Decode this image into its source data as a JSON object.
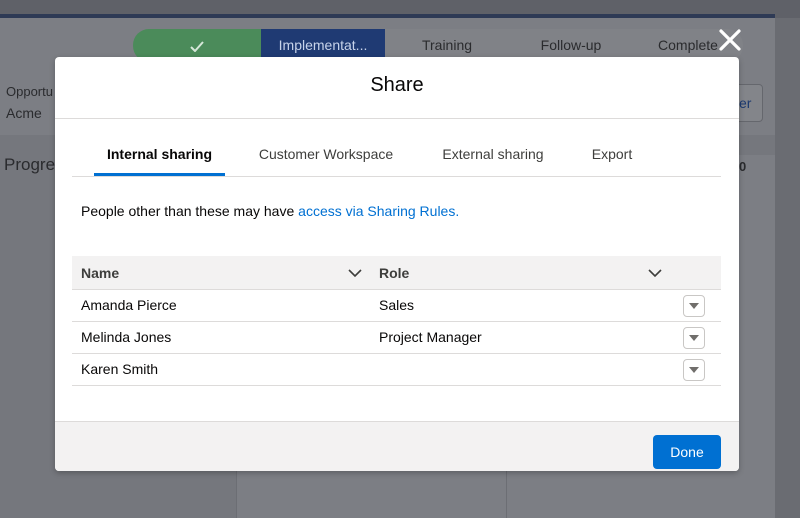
{
  "background": {
    "path_steps": [
      "",
      "Implementat...",
      "Training",
      "Follow-up",
      "Complete"
    ],
    "opportunity_label": "Opportu",
    "account_name": "Acme",
    "section_title": "Progres",
    "header_button_label": "er",
    "right_value": "0"
  },
  "modal": {
    "title": "Share",
    "tabs": [
      "Internal sharing",
      "Customer Workspace",
      "External sharing",
      "Export"
    ],
    "active_tab": "Internal sharing",
    "info_text": "People other than these may have ",
    "info_link": "access via Sharing Rules.",
    "table": {
      "columns": [
        "Name",
        "Role"
      ],
      "rows": [
        {
          "name": "Amanda Pierce",
          "role": "Sales"
        },
        {
          "name": "Melinda Jones",
          "role": "Project Manager"
        },
        {
          "name": "Karen Smith",
          "role": ""
        }
      ]
    },
    "footer": {
      "done_label": "Done"
    }
  },
  "colors": {
    "accent": "#0070d2",
    "path_done": "#4b8b5a",
    "path_current": "#1f3a73"
  }
}
